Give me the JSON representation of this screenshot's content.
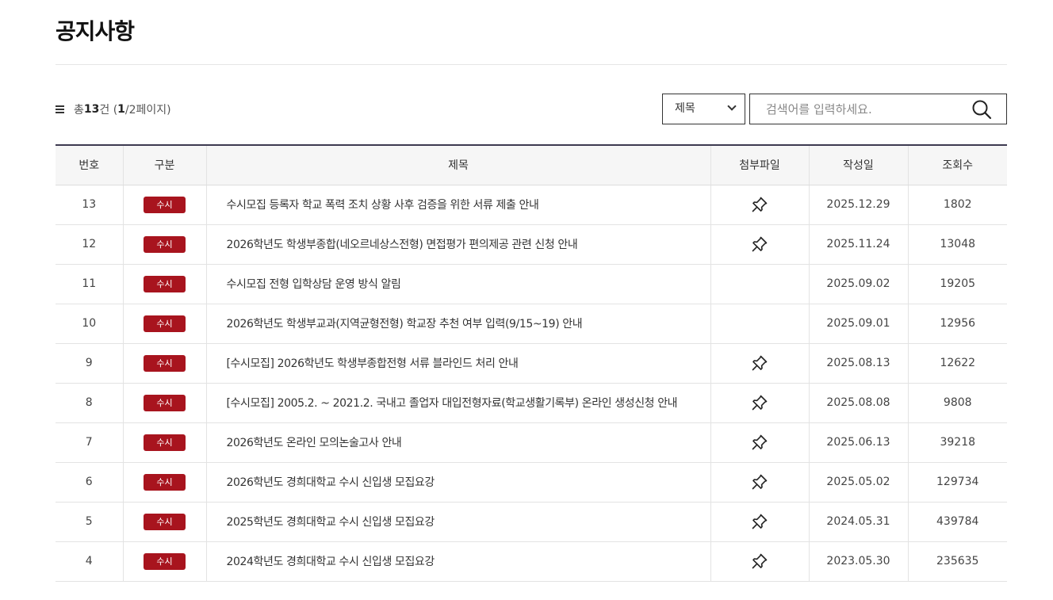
{
  "page": {
    "title": "공지사항"
  },
  "summary": {
    "prefix": "총 ",
    "count": "13",
    "count_suffix": "건 (",
    "page": "1",
    "page_suffix": "/2페이지)"
  },
  "search": {
    "select_value": "제목",
    "placeholder": "검색어를 입력하세요."
  },
  "table": {
    "headers": {
      "no": "번호",
      "category": "구분",
      "title": "제목",
      "attachment": "첨부파일",
      "date": "작성일",
      "views": "조회수"
    },
    "rows": [
      {
        "no": "13",
        "category": "수시",
        "title": "수시모집 등록자 학교 폭력 조치 상황 사후 검증을 위한 서류 제출 안내",
        "attachment": true,
        "date": "2025.12.29",
        "views": "1802"
      },
      {
        "no": "12",
        "category": "수시",
        "title": "2026학년도 학생부종합(네오르네상스전형) 면접평가 편의제공 관련 신청 안내",
        "attachment": true,
        "date": "2025.11.24",
        "views": "13048"
      },
      {
        "no": "11",
        "category": "수시",
        "title": "수시모집 전형 입학상담 운영 방식 알림",
        "attachment": false,
        "date": "2025.09.02",
        "views": "19205"
      },
      {
        "no": "10",
        "category": "수시",
        "title": "2026학년도 학생부교과(지역균형전형) 학교장 추천 여부 입력(9/15~19) 안내",
        "attachment": false,
        "date": "2025.09.01",
        "views": "12956"
      },
      {
        "no": "9",
        "category": "수시",
        "title": "[수시모집] 2026학년도 학생부종합전형 서류 블라인드 처리 안내",
        "attachment": true,
        "date": "2025.08.13",
        "views": "12622"
      },
      {
        "no": "8",
        "category": "수시",
        "title": "[수시모집] 2005.2. ~ 2021.2. 국내고 졸업자 대입전형자료(학교생활기록부) 온라인 생성신청 안내",
        "attachment": true,
        "date": "2025.08.08",
        "views": "9808"
      },
      {
        "no": "7",
        "category": "수시",
        "title": "2026학년도 온라인 모의논술고사 안내",
        "attachment": true,
        "date": "2025.06.13",
        "views": "39218"
      },
      {
        "no": "6",
        "category": "수시",
        "title": "2026학년도 경희대학교 수시 신입생 모집요강",
        "attachment": true,
        "date": "2025.05.02",
        "views": "129734"
      },
      {
        "no": "5",
        "category": "수시",
        "title": "2025학년도 경희대학교 수시 신입생 모집요강",
        "attachment": true,
        "date": "2024.05.31",
        "views": "439784"
      },
      {
        "no": "4",
        "category": "수시",
        "title": "2024학년도 경희대학교 수시 신입생 모집요강",
        "attachment": true,
        "date": "2023.05.30",
        "views": "235635"
      }
    ]
  },
  "colors": {
    "badge": "#a8141e",
    "header_rule": "#3d3a50"
  },
  "icons": {
    "attachment": "pushpin-icon",
    "search": "magnifier-icon",
    "list": "hamburger-icon"
  }
}
